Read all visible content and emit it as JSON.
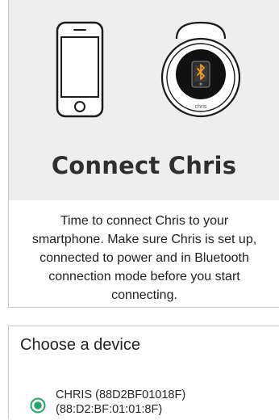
{
  "hero": {
    "title": "Connect Chris",
    "device_brand": "chris",
    "background": "#eeeeee"
  },
  "intro": {
    "text": "Time to connect Chris to your smartphone. Make sure Chris is set up, connected to power and in Bluetooth connection mode before you start connecting."
  },
  "dialog": {
    "title": "Choose a device",
    "options": [
      {
        "label": "CHRIS (88D2BF01018F) (88:D2:BF:01:01:8F)",
        "selected": true
      }
    ]
  },
  "colors": {
    "accent": "#2aa36b",
    "bluetooth_orange": "#f39b1f",
    "title_text": "#2f2f2f"
  },
  "icons": [
    "smartphone-icon",
    "chris-device-icon",
    "bluetooth-icon",
    "radio-selected-icon"
  ]
}
